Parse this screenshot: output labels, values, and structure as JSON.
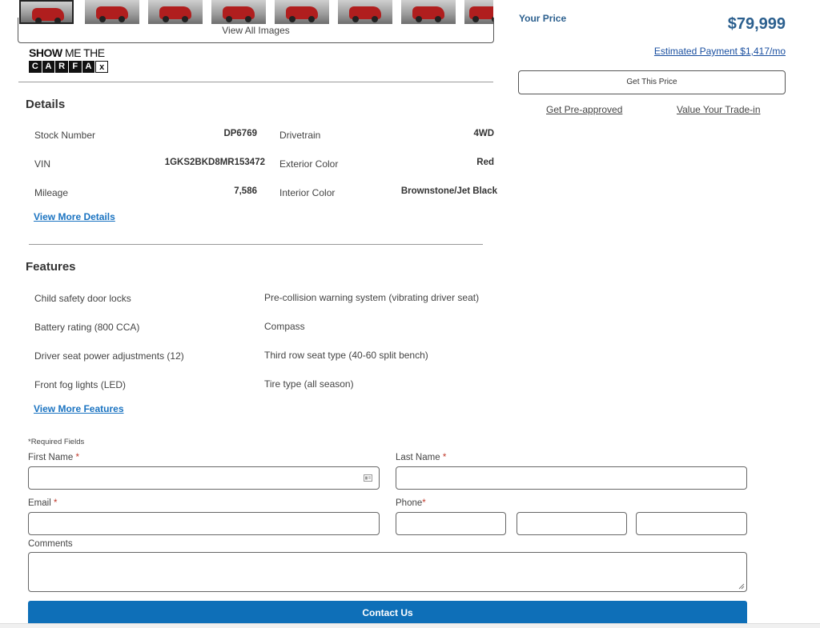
{
  "gallery": {
    "thumbnails": [
      "thumbnail-1",
      "thumbnail-2",
      "thumbnail-3",
      "thumbnail-4",
      "thumbnail-5",
      "thumbnail-6",
      "thumbnail-7",
      "thumbnail-8"
    ],
    "view_all_label": "View All Images"
  },
  "carfax": {
    "show_me": "SHOW",
    "me_the": " ME THE",
    "letters": [
      "C",
      "A",
      "R",
      "F",
      "A",
      "x"
    ]
  },
  "details": {
    "heading": "Details",
    "left": [
      {
        "label": "Stock Number",
        "value": "DP6769"
      },
      {
        "label": "VIN",
        "value": "1GKS2BKD8MR153472"
      },
      {
        "label": "Mileage",
        "value": "7,586"
      }
    ],
    "right": [
      {
        "label": "Drivetrain",
        "value": "4WD"
      },
      {
        "label": "Exterior Color",
        "value": "Red"
      },
      {
        "label": "Interior Color",
        "value": "Brownstone/Jet Black"
      }
    ],
    "more_link": "View More Details"
  },
  "features": {
    "heading": "Features",
    "left": [
      "Child safety door locks",
      "Battery rating (800 CCA)",
      "Driver seat power adjustments (12)",
      "Front fog lights (LED)"
    ],
    "right": [
      "Pre-collision warning system (vibrating driver seat)",
      "Compass",
      "Third row seat type (40-60 split bench)",
      "Tire type (all season)"
    ],
    "more_link": "View More Features"
  },
  "form": {
    "required_note": "*Required Fields",
    "first_name": "First Name",
    "last_name": "Last Name",
    "email": "Email",
    "phone": "Phone",
    "comments": "Comments",
    "required_mark": "*",
    "submit_label": "Contact Us"
  },
  "pricing": {
    "your_price_label": "Your Price",
    "price": "$79,999",
    "estimated_payment": "Estimated Payment $1,417/mo",
    "get_price_label": "Get This Price",
    "pre_approved": "Get Pre-approved",
    "trade_in": "Value Your Trade-in"
  },
  "colors": {
    "accent": "#2b5f8e",
    "link": "#1a73c1",
    "button": "#0e6fb8",
    "required": "#c0392b"
  }
}
